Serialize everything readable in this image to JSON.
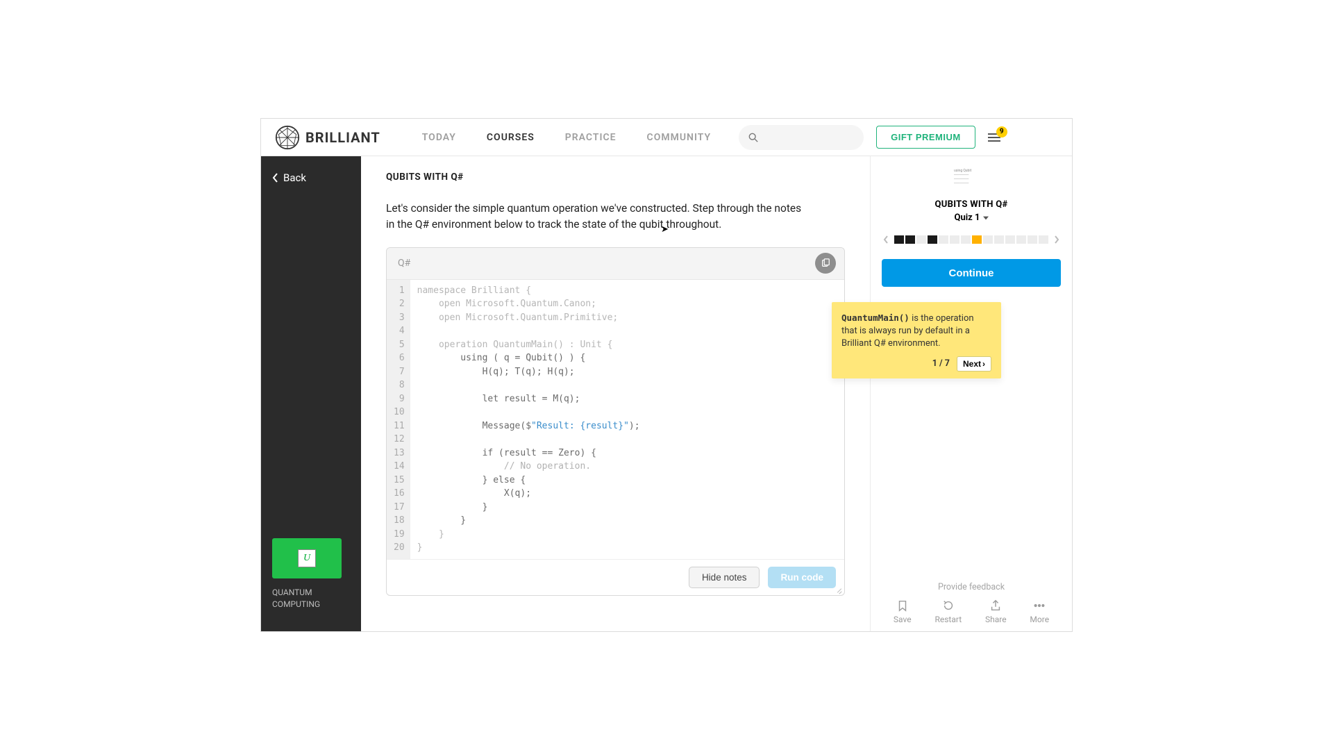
{
  "header": {
    "brand": "BRILLIANT",
    "nav": [
      "TODAY",
      "COURSES",
      "PRACTICE",
      "COMMUNITY"
    ],
    "nav_active_index": 1,
    "gift_label": "GIFT PREMIUM",
    "badge_count": "9"
  },
  "sidebar": {
    "back_label": "Back",
    "course_name": "QUANTUM COMPUTING",
    "thumb_letter": "U"
  },
  "lesson": {
    "title": "QUBITS WITH Q#",
    "description": "Let's consider the simple quantum operation we've constructed. Step through the notes in the Q# environment below to track the state of the qubit throughout.",
    "language_label": "Q#",
    "line_numbers": [
      "1",
      "2",
      "3",
      "4",
      "5",
      "6",
      "7",
      "8",
      "9",
      "10",
      "11",
      "12",
      "13",
      "14",
      "15",
      "16",
      "17",
      "18",
      "19",
      "20"
    ],
    "hide_notes_label": "Hide notes",
    "run_label": "Run code"
  },
  "right": {
    "title": "QUBITS WITH Q#",
    "quiz_label": "Quiz 1",
    "continue_label": "Continue",
    "feedback_label": "Provide feedback",
    "actions": {
      "save": "Save",
      "restart": "Restart",
      "share": "Share",
      "more": "More"
    },
    "progress": [
      "done",
      "done",
      "blank",
      "done",
      "blank",
      "blank",
      "blank",
      "current",
      "blank",
      "blank",
      "blank",
      "blank",
      "blank",
      "blank"
    ]
  },
  "callout": {
    "code": "QuantumMain()",
    "text_rest": " is the operation that is always run by default in a Brilliant Q# environment.",
    "page": "1 / 7",
    "next_label": "Next"
  }
}
